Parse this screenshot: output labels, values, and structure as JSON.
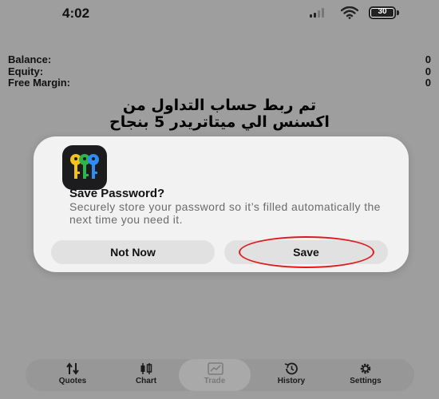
{
  "status_bar": {
    "time": "4:02",
    "battery_level": "30",
    "icons": [
      "signal-icon",
      "wifi-icon",
      "battery-icon"
    ]
  },
  "account": {
    "rows": [
      {
        "label": "Balance:",
        "value": "0"
      },
      {
        "label": "Equity:",
        "value": "0"
      },
      {
        "label": "Free Margin:",
        "value": "0"
      }
    ]
  },
  "message": {
    "line1": "تم ربط حساب التداول من",
    "line2": "اكسنس الي ميتاتريدر 5 بنجاح"
  },
  "dialog": {
    "app_icon": "keys-icon",
    "title": "Save Password?",
    "description": "Securely store your password so it’s filled automatically the next time you need it.",
    "not_now_label": "Not Now",
    "save_label": "Save",
    "highlight_color": "#e0191d"
  },
  "tab_bar": {
    "tabs": [
      {
        "label": "Quotes",
        "icon": "arrows-updown-icon",
        "active": false
      },
      {
        "label": "Chart",
        "icon": "candlestick-icon",
        "active": false
      },
      {
        "label": "Trade",
        "icon": "trade-chart-icon",
        "active": true
      },
      {
        "label": "History",
        "icon": "history-icon",
        "active": false
      },
      {
        "label": "Settings",
        "icon": "gear-icon",
        "active": false
      }
    ]
  }
}
